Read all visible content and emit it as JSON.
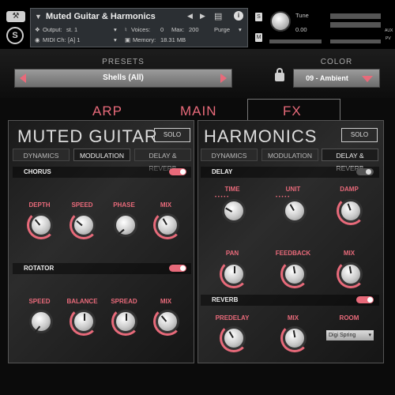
{
  "header": {
    "title": "Muted Guitar & Harmonics",
    "output_label": "Output:",
    "output_value": "st. 1",
    "midi_label": "MIDI Ch:",
    "midi_value": "[A] 1",
    "voices_label": "Voices:",
    "voices_value": "0",
    "max_label": "Max:",
    "max_value": "200",
    "purge": "Purge",
    "memory_label": "Memory:",
    "memory_value": "18.31 MB",
    "tune_label": "Tune",
    "tune_value": "0.00",
    "s_btn": "S",
    "m_btn": "M",
    "aux": "AUX",
    "pv": "PV"
  },
  "presets": {
    "label": "PRESETS",
    "value": "Shells (All)"
  },
  "color": {
    "label": "COLOR",
    "value": "09 - Ambient"
  },
  "tabs": [
    "ARP",
    "MAIN",
    "FX"
  ],
  "left_panel": {
    "title": "MUTED GUITAR",
    "solo": "SOLO",
    "subtabs": [
      "DYNAMICS",
      "MODULATION",
      "DELAY & REVERB"
    ],
    "chorus": {
      "label": "CHORUS",
      "knobs": [
        "DEPTH",
        "SPEED",
        "PHASE",
        "MIX"
      ]
    },
    "rotator": {
      "label": "ROTATOR",
      "knobs": [
        "SPEED",
        "BALANCE",
        "SPREAD",
        "MIX"
      ]
    }
  },
  "right_panel": {
    "title": "HARMONICS",
    "solo": "SOLO",
    "subtabs": [
      "DYNAMICS",
      "MODULATION",
      "DELAY & REVERB"
    ],
    "delay": {
      "label": "DELAY",
      "knobs_row1": [
        "TIME",
        "UNIT",
        "DAMP"
      ],
      "knobs_row2": [
        "PAN",
        "FEEDBACK",
        "MIX"
      ]
    },
    "reverb": {
      "label": "REVERB",
      "knobs": [
        "PREDELAY",
        "MIX"
      ],
      "room_label": "ROOM",
      "room_value": "Digi Spring"
    }
  },
  "colors": {
    "accent": "#e86a7a"
  }
}
